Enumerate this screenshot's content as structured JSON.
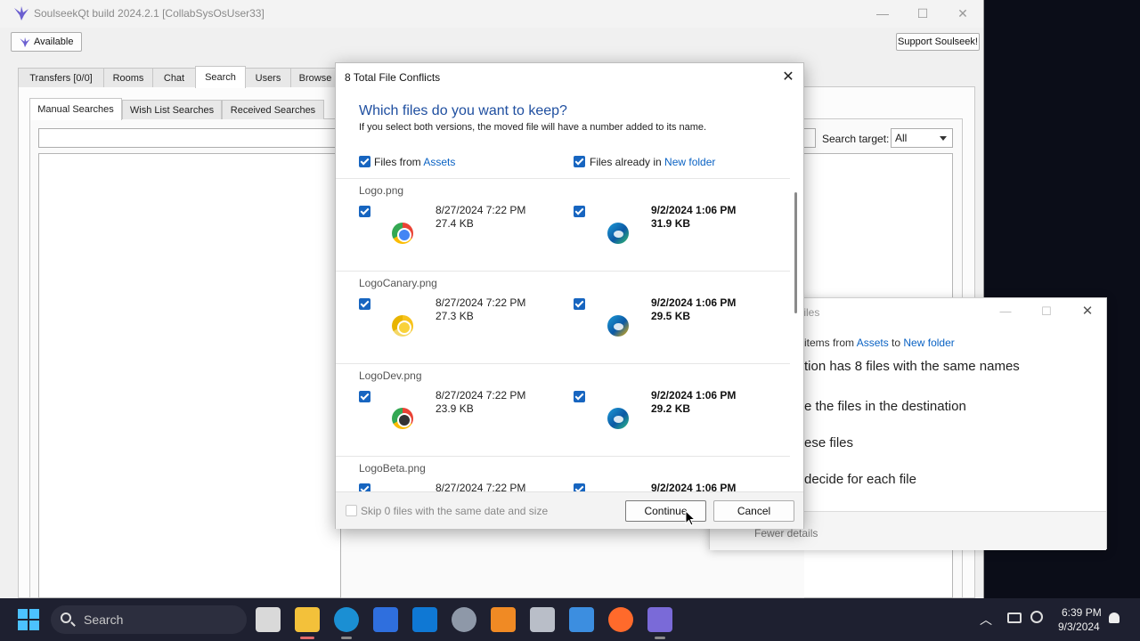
{
  "app": {
    "title": "SoulseekQt build 2024.2.1 [CollabSysOsUser33]",
    "status_label": "Available",
    "support_label": "Support Soulseek!",
    "window_controls": {
      "minimize": "—",
      "maximize": "☐",
      "close": "✕"
    }
  },
  "main_tabs": [
    {
      "label": "Transfers [0/0]"
    },
    {
      "label": "Rooms"
    },
    {
      "label": "Chat"
    },
    {
      "label": "Search"
    },
    {
      "label": "Users"
    },
    {
      "label": "Browse"
    }
  ],
  "search_tabs": [
    {
      "label": "Manual Searches"
    },
    {
      "label": "Wish List Searches"
    },
    {
      "label": "Received Searches"
    }
  ],
  "search_target": {
    "label": "Search target:",
    "value": "All"
  },
  "copy_dialog": {
    "title": "n Files",
    "items_prefix": "items from ",
    "source": "Assets",
    "to_text": " to ",
    "destination": "New folder",
    "heading": "tion has 8 files with the same names",
    "option_replace": "e the files in the destination",
    "option_skip": "ese files",
    "option_decide": "decide for each file",
    "fewer_details": "Fewer details"
  },
  "conflict_dialog": {
    "title": "8 Total File Conflicts",
    "close": "✕",
    "heading": "Which files do you want to keep?",
    "subtext": "If you select both versions, the moved file will have a number added to its name.",
    "left_column_prefix": "Files from ",
    "left_column_link": "Assets",
    "right_column_prefix": "Files already in ",
    "right_column_link": "New folder",
    "files": [
      {
        "name": "Logo.png",
        "left_date": "8/27/2024 7:22 PM",
        "left_size": "27.4 KB",
        "right_date": "9/2/2024 1:06 PM",
        "right_size": "31.9 KB",
        "left_icon": "chrome-icon",
        "right_icon": "edge-icon"
      },
      {
        "name": "LogoCanary.png",
        "left_date": "8/27/2024 7:22 PM",
        "left_size": "27.3 KB",
        "right_date": "9/2/2024 1:06 PM",
        "right_size": "29.5 KB",
        "left_icon": "chrome-canary-icon",
        "right_icon": "edge-canary-icon"
      },
      {
        "name": "LogoDev.png",
        "left_date": "8/27/2024 7:22 PM",
        "left_size": "23.9 KB",
        "right_date": "9/2/2024 1:06 PM",
        "right_size": "29.2 KB",
        "left_icon": "chrome-dev-icon",
        "right_icon": "edge-dev-icon"
      },
      {
        "name": "LogoBeta.png",
        "left_date": "8/27/2024 7:22 PM",
        "left_size": "",
        "right_date": "9/2/2024 1:06 PM",
        "right_size": "",
        "left_icon": "",
        "right_icon": ""
      }
    ],
    "skip_label": "Skip 0 files with the same date and size",
    "continue_label": "Continue",
    "cancel_label": "Cancel"
  },
  "taskbar": {
    "search_placeholder": "Search",
    "apps": [
      {
        "name": "task-view-icon",
        "color": "#d9d9d9"
      },
      {
        "name": "file-explorer-icon",
        "color": "#f3c13a"
      },
      {
        "name": "edge-icon",
        "color": "#1b8fd3"
      },
      {
        "name": "microsoft-store-icon",
        "color": "#2f6fde"
      },
      {
        "name": "outlook-icon",
        "color": "#0f78d4"
      },
      {
        "name": "settings-icon",
        "color": "#8e98a8"
      },
      {
        "name": "search-tool-icon",
        "color": "#f08a24"
      },
      {
        "name": "terminal-icon",
        "color": "#b9bec8"
      },
      {
        "name": "paint-icon",
        "color": "#3c8ee0"
      },
      {
        "name": "firefox-icon",
        "color": "#ff6a2b"
      },
      {
        "name": "soulseek-icon",
        "color": "#7a6ad8"
      }
    ],
    "tray_chevron": "︿",
    "time": "6:39 PM",
    "date": "9/3/2024"
  }
}
